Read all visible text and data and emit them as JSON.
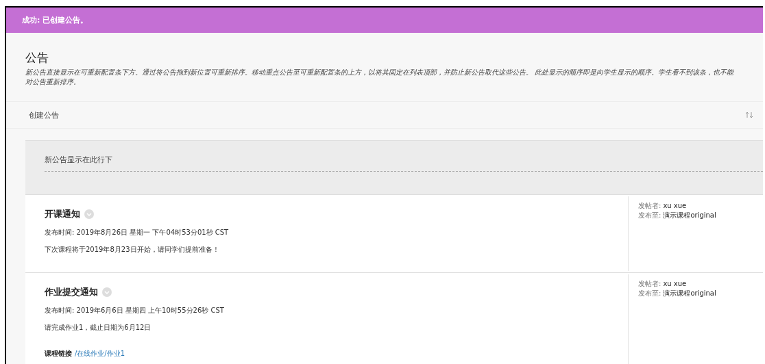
{
  "banner": {
    "message": "成功: 已创建公告。"
  },
  "header": {
    "title": "公告",
    "description": "新公告直接显示在可重新配置条下方。通过将公告拖到新位置可重新排序。移动重点公告至可重新配置条的上方，以将其固定在列表顶部，并防止新公告取代这些公告。 此处显示的顺序即是向学生显示的顺序。学生看不到该条，也不能对公告重新排序。"
  },
  "toolbar": {
    "create_button": "创建公告"
  },
  "divider_label": "新公告显示在此行下",
  "announcements": [
    {
      "title": "开课通知",
      "posted_time": "发布时间: 2019年8月26日 星期一 下午04时53分01秒 CST",
      "body": "下次课程将于2019年8月23日开始，请同学们提前准备！",
      "author_label": "发帖者:",
      "author": "xu xue",
      "posted_to_label": "发布至:",
      "posted_to": "演示课程original"
    },
    {
      "title": "作业提交通知",
      "posted_time": "发布时间: 2019年6月6日 星期四 上午10时55分26秒 CST",
      "body": "请完成作业1，截止日期为6月12日",
      "link_label": "课程链接",
      "link": "/在线作业/作业1",
      "author_label": "发帖者:",
      "author": "xu xue",
      "posted_to_label": "发布至:",
      "posted_to": "演示课程original"
    }
  ]
}
